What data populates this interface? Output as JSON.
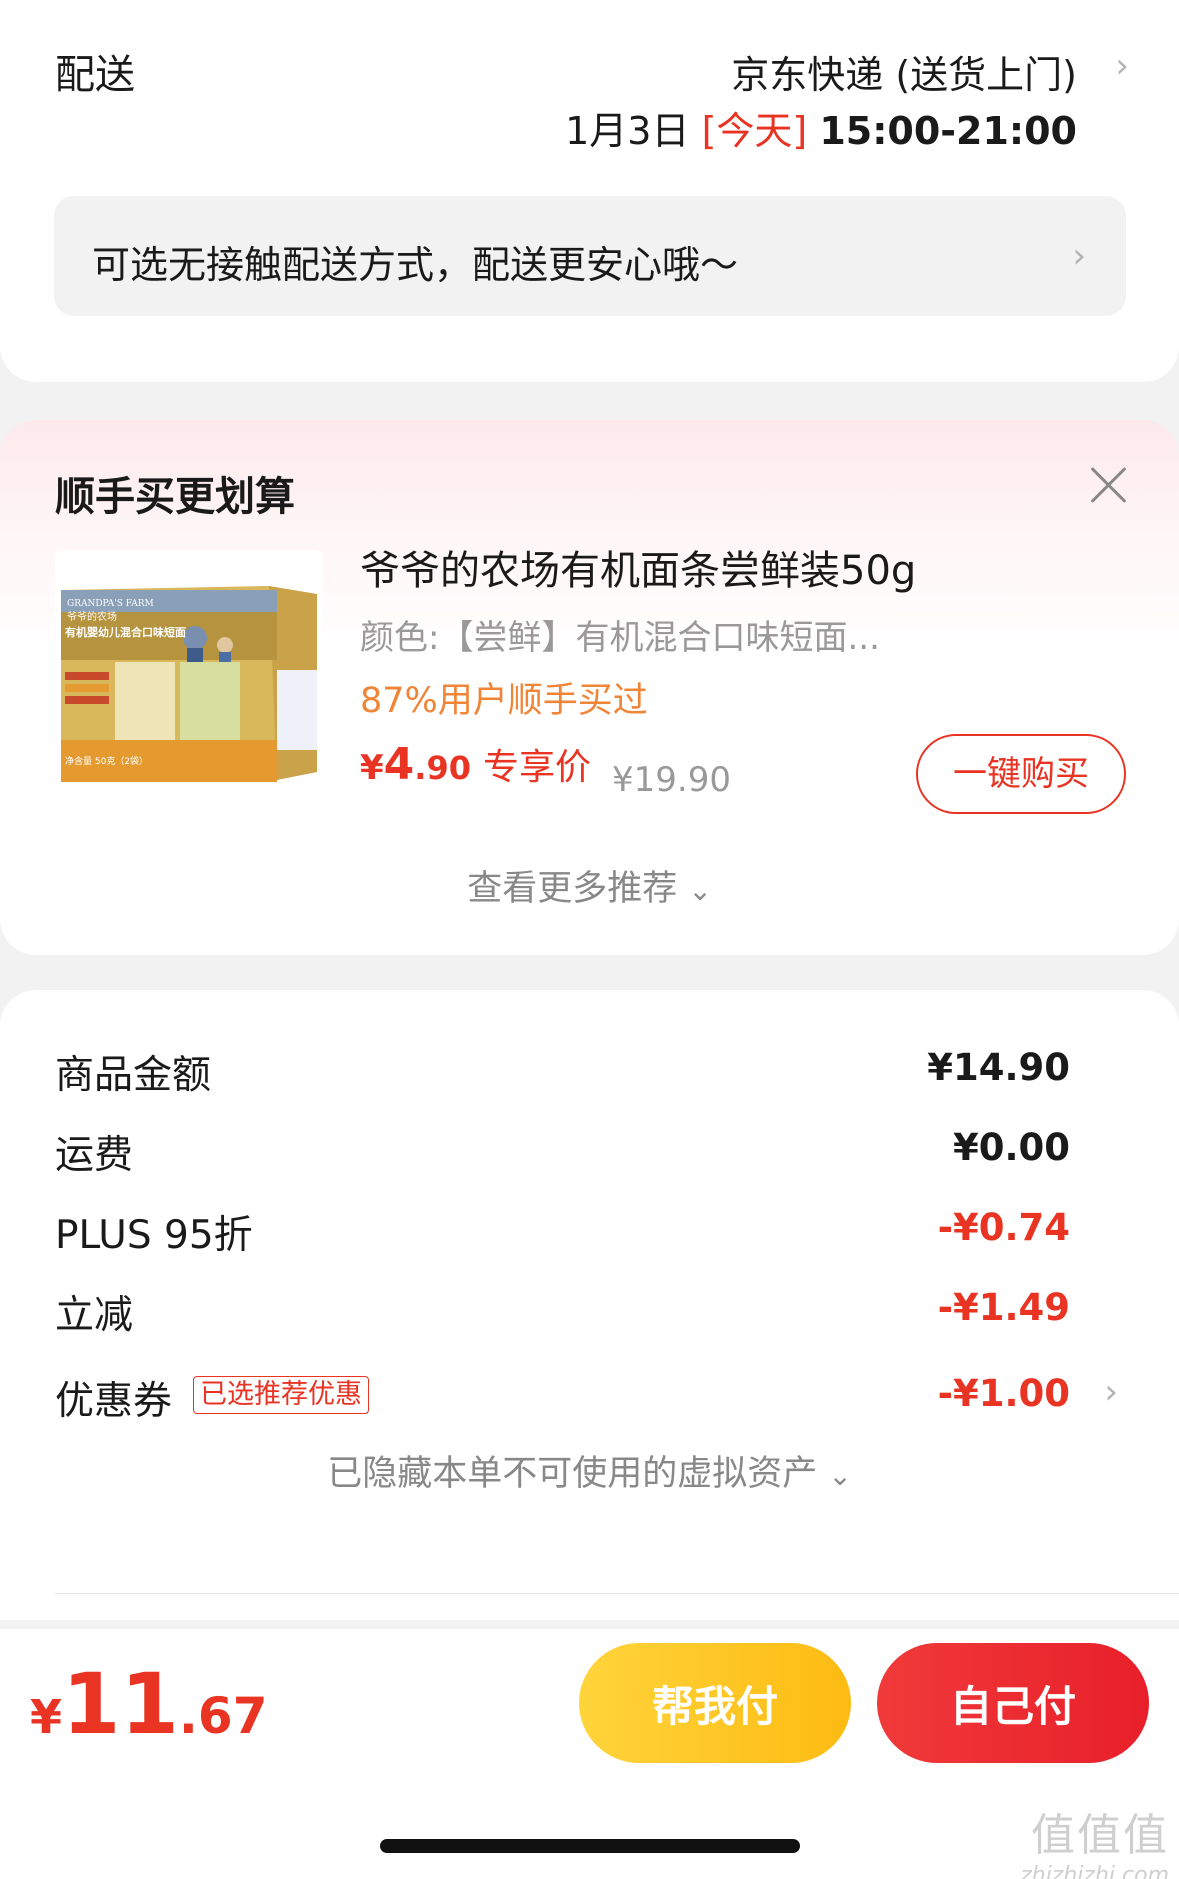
{
  "delivery": {
    "label": "配送",
    "method": "京东快递 (送货上门)",
    "date": "1月3日",
    "today_tag": "[今天]",
    "time_range": "15:00-21:00",
    "contactless_text": "可选无接触配送方式，配送更安心哦～"
  },
  "recommendation": {
    "title": "顺手买更划算",
    "product": {
      "name": "爷爷的农场有机面条尝鲜装50g",
      "spec": "颜色:【尝鲜】有机混合口味短面...",
      "social_proof": "87%用户顺手买过",
      "price_symbol": "¥",
      "price_int": "4",
      "price_dec": ".90",
      "price_tag": "专享价",
      "original_price": "¥19.90",
      "buy_button": "一键购买",
      "image_texts": {
        "brand": "GRANDPA'S FARM",
        "brand_cn": "爷爷的农场",
        "subtitle": "有机婴幼儿混合口味短面",
        "net_weight": "净含量  50克（2袋）"
      }
    },
    "more_label": "查看更多推荐"
  },
  "summary": {
    "rows": [
      {
        "label": "商品金额",
        "value": "¥14.90"
      },
      {
        "label": "运费",
        "value": "¥0.00"
      },
      {
        "label": "PLUS 95折",
        "value": "-¥0.74"
      },
      {
        "label": "立减",
        "value": "-¥1.49"
      },
      {
        "label": "优惠券",
        "value": "-¥1.00",
        "badge": "已选推荐优惠"
      }
    ],
    "hidden_assets": "已隐藏本单不可使用的虚拟资产"
  },
  "bottom_bar": {
    "total_symbol": "¥",
    "total_int": "11",
    "total_dec": ".67",
    "help_pay": "帮我付",
    "self_pay": "自己付"
  },
  "watermark": {
    "line1": "值值值",
    "line2": "zhizhizhi.com"
  },
  "colors": {
    "accent_red": "#e93323",
    "social_orange": "#f08437",
    "help_pay_yellow": "#fdbb12",
    "self_pay_red": "#e81f2a"
  }
}
